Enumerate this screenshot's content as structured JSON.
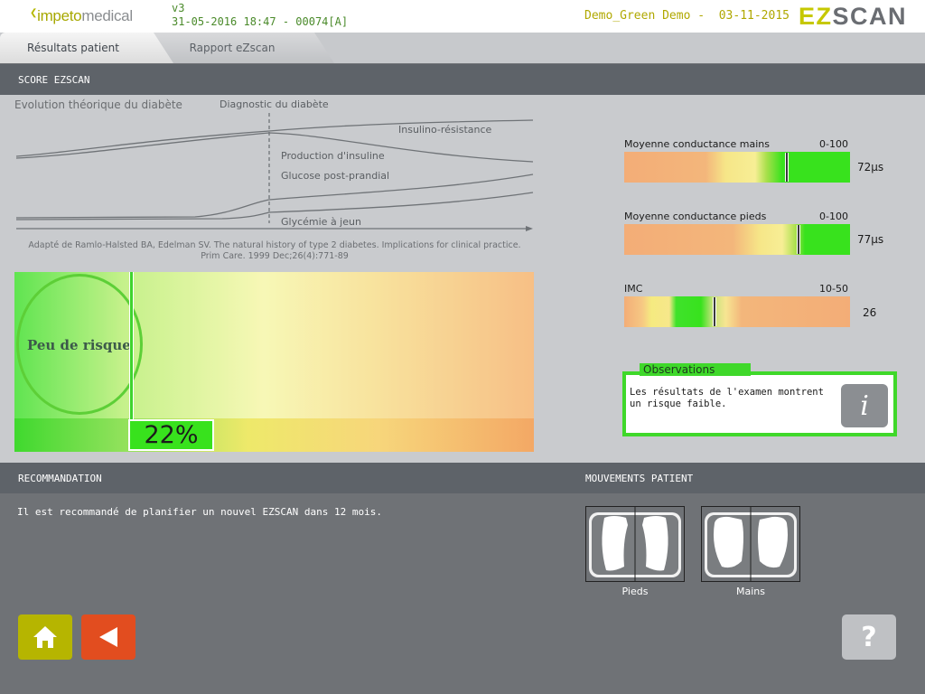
{
  "header": {
    "brand_prefix": "impeto",
    "brand_suffix": "medical",
    "version": "v3",
    "session": "31-05-2016 18:47 - 00074[A]",
    "patient": "Demo_Green Demo -  03-11-2015",
    "product_ez": "EZ",
    "product_scan": "SCAN"
  },
  "tabs": [
    {
      "label": "Résultats patient",
      "active": true
    },
    {
      "label": "Rapport eZscan",
      "active": false
    }
  ],
  "score": {
    "section_title": "SCORE EZSCAN",
    "diagram_title": "Evolution théorique du diabète",
    "labels": {
      "diagnostic": "Diagnostic du diabète",
      "insulino": "Insulino-résistance",
      "production": "Production d'insuline",
      "glucose": "Glucose post-prandial",
      "glycemie": "Glycémie à jeun"
    },
    "citation_line1": "Adapté de Ramlo-Halsted BA, Edelman SV. The natural history of type 2 diabetes. Implications for clinical practice.",
    "citation_line2": "Prim Care. 1999 Dec;26(4):771-89",
    "risk_label": "Peu de risque",
    "risk_percent_text": "22%",
    "risk_percent": 22
  },
  "measures": [
    {
      "title": "Moyenne conductance mains",
      "range": "0-100",
      "value": "72µs",
      "marker": 72,
      "min": 0,
      "max": 100,
      "gradient": "linear-gradient(to right, #f3ad77 0%, #f3b67b 36%, #f6e688 45%, #f7ee95 58%, #a9e04c 63%, #38e21d 70%, #38e21d 100%)"
    },
    {
      "title": "Moyenne conductance pieds",
      "range": "0-100",
      "value": "77µs",
      "marker": 77,
      "min": 0,
      "max": 100,
      "gradient": "linear-gradient(to right, #f3ad77 0%, #f3b67b 48%, #f6e688 60%, #f7ee95 70%, #a9e04c 76%, #38e21d 80%, #38e21d 100%)"
    },
    {
      "title": "IMC",
      "range": "10-50",
      "value": "26",
      "marker": 26,
      "min": 10,
      "max": 50,
      "gradient": "linear-gradient(to right, #f3ad77 0%, #f6c883 8%, #f5ea80 12%, #f7e78b 20%, #3fe22b 23%, #38e21d 34%, #c3e279 39%, #f7e592 45%, #f3b67b 52%, #f3ad77 100%)"
    }
  ],
  "observations": {
    "title": "Observations",
    "text": "Les résultats de l'examen montrent un risque faible.",
    "info_glyph": "i"
  },
  "recommendation": {
    "section_title": "RECOMMANDATION",
    "text": "Il est recommandé de planifier un nouvel EZSCAN dans 12 mois."
  },
  "movements": {
    "section_title": "MOUVEMENTS PATIENT",
    "feet_label": "Pieds",
    "hands_label": "Mains"
  },
  "buttons": {
    "home_icon": "home-icon",
    "back_icon": "back-arrow-icon",
    "help_label": "?"
  },
  "colors": {
    "accent_green": "#3fd82a",
    "home_button": "#b6b500",
    "back_button": "#e24d1f",
    "help_button": "#bfc1c4"
  }
}
